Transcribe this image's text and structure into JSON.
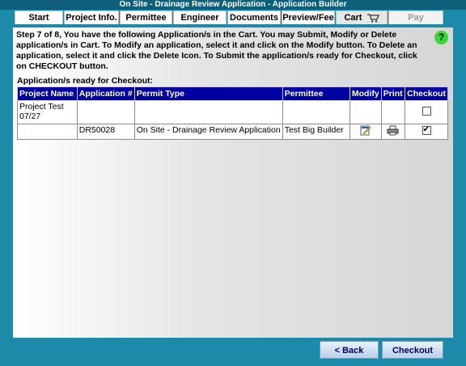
{
  "window": {
    "title": "On Site - Drainage Review Application - Application Builder"
  },
  "tabs": [
    {
      "label": "Start"
    },
    {
      "label": "Project Info."
    },
    {
      "label": "Permittee"
    },
    {
      "label": "Engineer"
    },
    {
      "label": "Documents"
    },
    {
      "label": "Preview/Fee"
    },
    {
      "label": "Cart"
    },
    {
      "label": "Pay"
    }
  ],
  "instructions": "Step 7 of 8, You have the following Application/s in the Cart. You may Submit, Modify or Delete application/s in Cart. To Modify an application, select it and click on the Modify button. To Delete an application, select it and click the Delete Icon. To Submit the application/s ready for Checkout, click on CHECKOUT button.",
  "section_title": "Application/s ready for Checkout:",
  "table": {
    "headers": [
      "Project Name",
      "Application #",
      "Permit Type",
      "Permittee",
      "Modify",
      "Print",
      "Checkout"
    ],
    "rows": [
      {
        "project_name": "Project Test 07/27",
        "application_no": "",
        "permit_type": "",
        "permittee": "",
        "checkout_checked": false
      },
      {
        "project_name": "",
        "application_no": "DR50028",
        "permit_type": "On Site - Drainage Review Application",
        "permittee": "Test Big Builder",
        "checkout_checked": true
      }
    ]
  },
  "buttons": {
    "back": "< Back",
    "checkout": "Checkout"
  },
  "icons": {
    "help": "?"
  }
}
